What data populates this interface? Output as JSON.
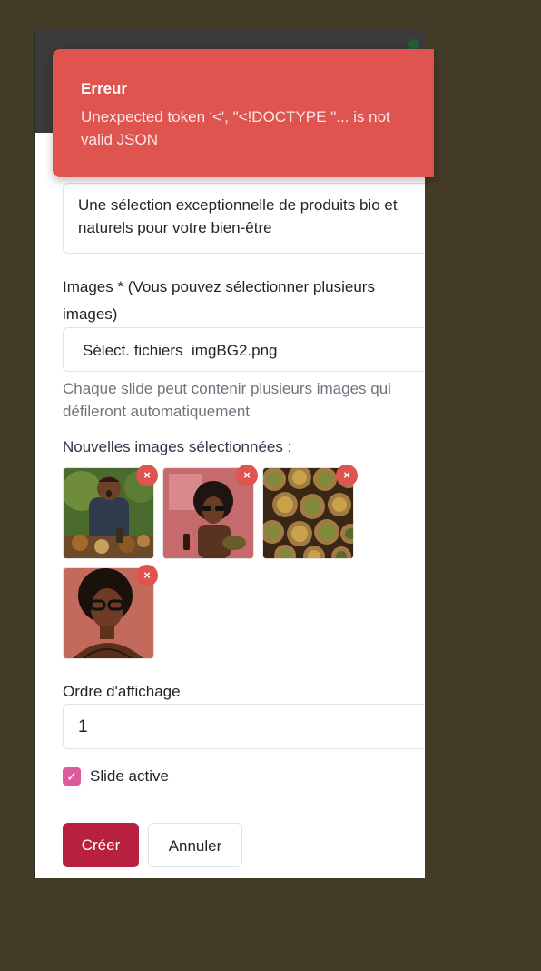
{
  "toast": {
    "title": "Erreur",
    "message": "Unexpected token '<', \"<!DOCTYPE \"... is not valid JSON"
  },
  "form": {
    "description": "Une sélection exceptionnelle de produits bio et naturels pour votre bien-être",
    "images_label": "Images * (Vous pouvez sélectionner plusieurs images)",
    "file_button": "Sélect. fichiers",
    "file_name": "imgBG2.png",
    "images_help": "Chaque slide peut contenir plusieurs images qui défileront automatiquement",
    "new_images_label": "Nouvelles images sélectionnées :",
    "remove_glyph": "×",
    "order_label": "Ordre d'affichage",
    "order_value": "1",
    "active_label": "Slide active",
    "active_checked": true,
    "check_glyph": "✓",
    "create_button": "Créer",
    "cancel_button": "Annuler"
  },
  "colors": {
    "error": "#e0544f",
    "primary": "#b8203f",
    "checkbox": "#dd5a9b",
    "backdrop": "#433b25"
  }
}
